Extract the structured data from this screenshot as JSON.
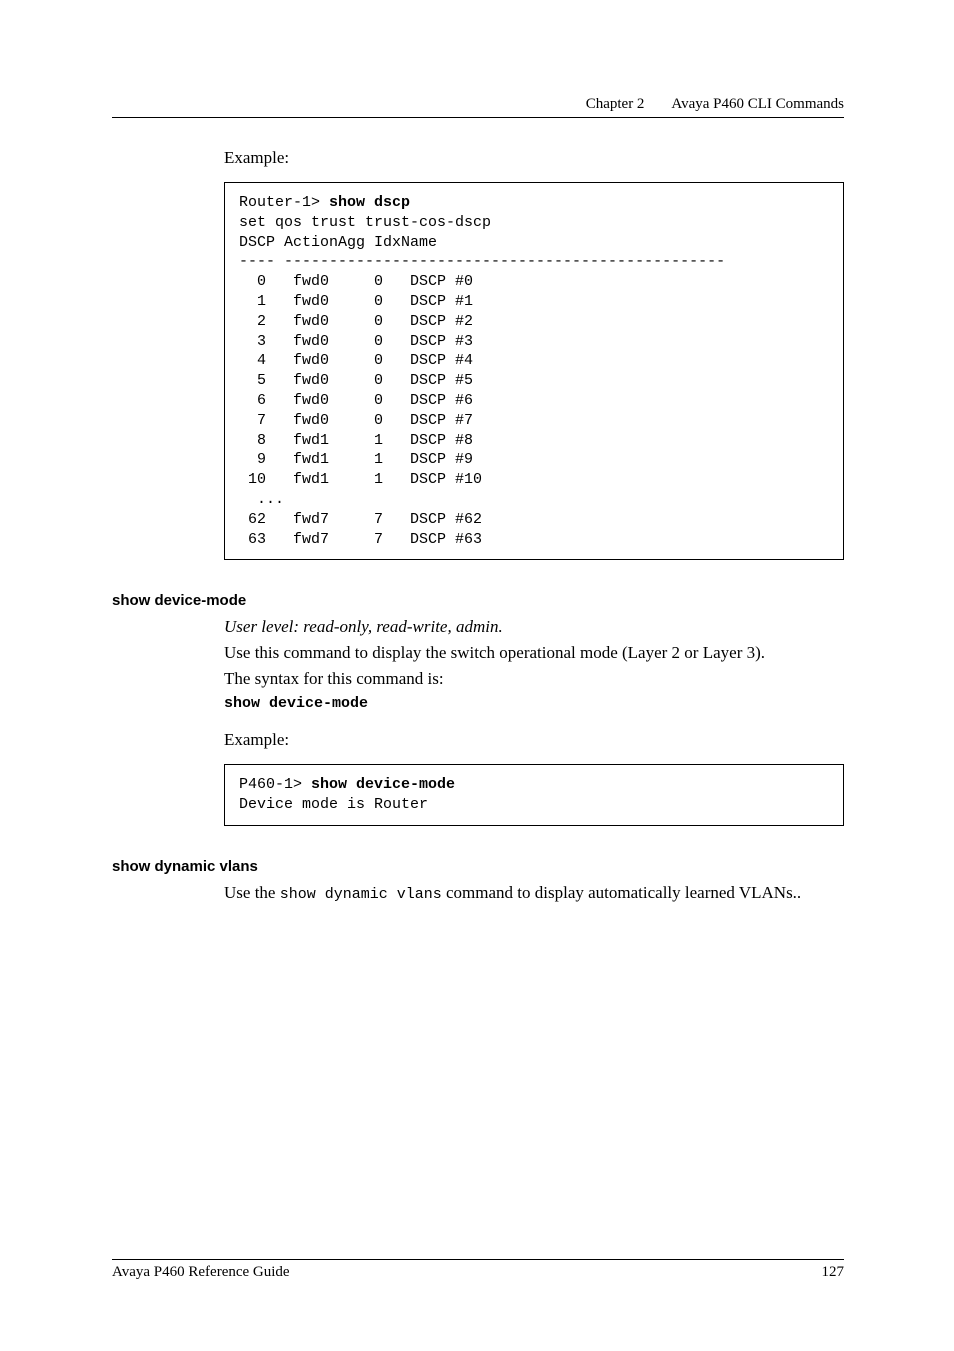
{
  "header": {
    "chapter": "Chapter 2",
    "title": "Avaya P460 CLI Commands"
  },
  "example1": {
    "label": "Example:",
    "prompt": "Router-1> ",
    "cmd": "show dscp",
    "line2": "set qos trust trust-cos-dscp",
    "line3": "DSCP ActionAgg IdxName",
    "line4": "---- -------------------------------------------------",
    "rows": [
      "  0   fwd0     0   DSCP #0",
      "  1   fwd0     0   DSCP #1",
      "  2   fwd0     0   DSCP #2",
      "  3   fwd0     0   DSCP #3",
      "  4   fwd0     0   DSCP #4",
      "  5   fwd0     0   DSCP #5",
      "  6   fwd0     0   DSCP #6",
      "  7   fwd0     0   DSCP #7",
      "  8   fwd1     1   DSCP #8",
      "  9   fwd1     1   DSCP #9",
      " 10   fwd1     1   DSCP #10",
      "  ...",
      " 62   fwd7     7   DSCP #62",
      " 63   fwd7     7   DSCP #63"
    ]
  },
  "sec1": {
    "heading": "show device-mode",
    "userlevel": "User level: read-only, read-write, admin.",
    "desc": "Use this command to display the switch operational mode (Layer 2 or Layer 3).",
    "syntax_intro": "The syntax for this command is:",
    "syntax_cmd": "show device-mode",
    "example_label": "Example:",
    "prompt": "P460-1> ",
    "cmd": "show device-mode",
    "out": "Device mode is Router"
  },
  "sec2": {
    "heading": "show dynamic vlans",
    "para_pre": "Use the ",
    "para_cmd": "show dynamic vlans",
    "para_post": " command to display automatically learned VLANs.."
  },
  "footer": {
    "left": "Avaya P460 Reference Guide",
    "right": "127"
  },
  "chart_data": {
    "type": "table",
    "title": "DSCP ActionAgg IdxName",
    "columns": [
      "DSCP",
      "Action",
      "Agg Idx",
      "Name"
    ],
    "rows": [
      [
        0,
        "fwd0",
        0,
        "DSCP #0"
      ],
      [
        1,
        "fwd0",
        0,
        "DSCP #1"
      ],
      [
        2,
        "fwd0",
        0,
        "DSCP #2"
      ],
      [
        3,
        "fwd0",
        0,
        "DSCP #3"
      ],
      [
        4,
        "fwd0",
        0,
        "DSCP #4"
      ],
      [
        5,
        "fwd0",
        0,
        "DSCP #5"
      ],
      [
        6,
        "fwd0",
        0,
        "DSCP #6"
      ],
      [
        7,
        "fwd0",
        0,
        "DSCP #7"
      ],
      [
        8,
        "fwd1",
        1,
        "DSCP #8"
      ],
      [
        9,
        "fwd1",
        1,
        "DSCP #9"
      ],
      [
        10,
        "fwd1",
        1,
        "DSCP #10"
      ],
      [
        62,
        "fwd7",
        7,
        "DSCP #62"
      ],
      [
        63,
        "fwd7",
        7,
        "DSCP #63"
      ]
    ]
  }
}
